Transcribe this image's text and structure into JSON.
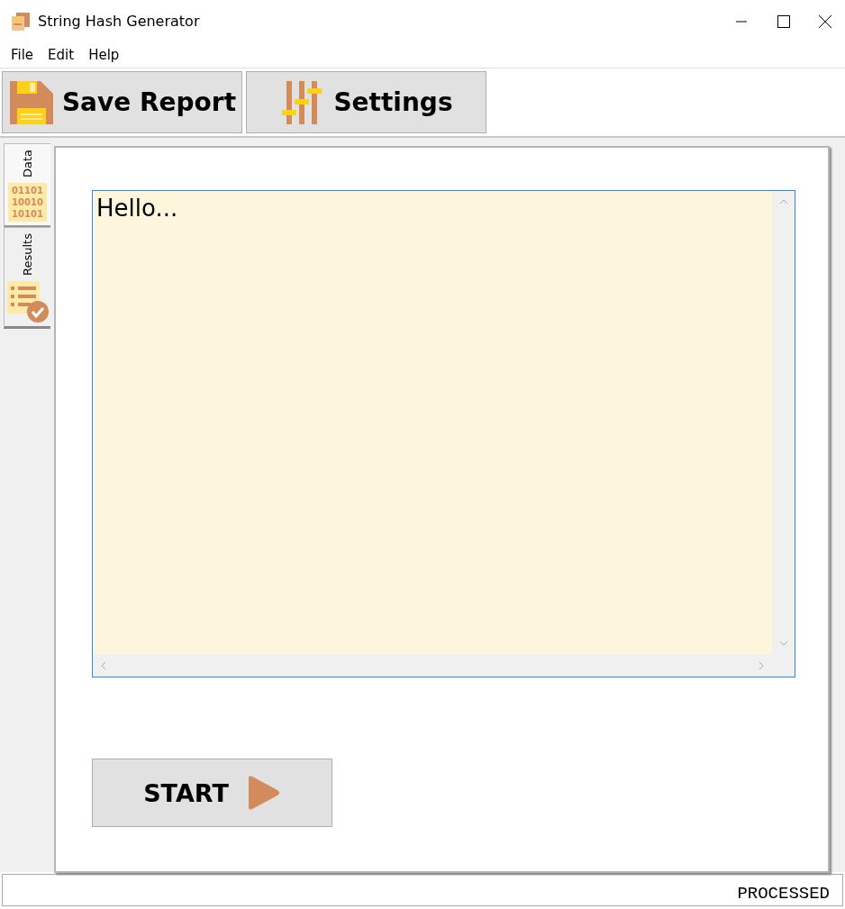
{
  "window": {
    "title": "String Hash Generator"
  },
  "menu": [
    "File",
    "Edit",
    "Help"
  ],
  "toolbar": [
    {
      "kind": "save",
      "label": "Save Report"
    },
    {
      "kind": "settings",
      "label": "Settings"
    }
  ],
  "tabs": [
    {
      "kind": "data",
      "label": "Data",
      "selected": true,
      "icon_lines": [
        "01101",
        "10010",
        "10101"
      ]
    },
    {
      "kind": "results",
      "label": "Results",
      "selected": false
    }
  ],
  "input": {
    "value": "Hello..."
  },
  "start_button": {
    "label": "START"
  },
  "status_bar": {
    "text": "PROCESSED"
  }
}
